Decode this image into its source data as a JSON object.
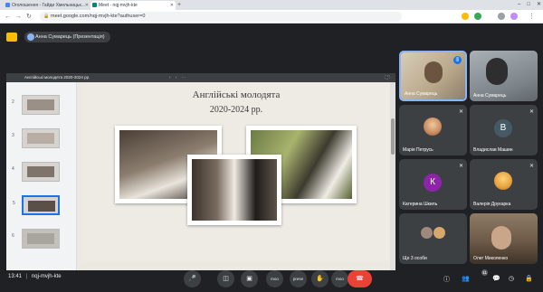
{
  "browser": {
    "tabs": [
      {
        "label": "Оголошення - Гайди Хмельницьк...",
        "fav_color": "#4285f4",
        "active": false
      },
      {
        "label": "Meet - nqj-mvjh-kte",
        "fav_color": "#00897b",
        "active": true
      }
    ],
    "url": "meet.google.com/nqj-mvjh-kte?authuser=0",
    "new_tab": "+",
    "window_controls": [
      "–",
      "□",
      "✕"
    ]
  },
  "meet": {
    "header_chip": "Анна Сумарець (Презентація)",
    "bottom": {
      "time": "13:41",
      "separator": "|",
      "meeting_code": "nqj-mvjh-kte"
    },
    "controls": [
      {
        "name": "mic-button",
        "glyph": "🎤"
      },
      {
        "name": "camera-button",
        "glyph": "◫"
      },
      {
        "name": "present-button",
        "glyph": "▣"
      },
      {
        "name": "more-button-1",
        "glyph": "moo",
        "small": true
      },
      {
        "name": "present-label-button",
        "glyph": "prese",
        "small": true
      },
      {
        "name": "raise-hand-button",
        "glyph": "✋"
      },
      {
        "name": "more-button-2",
        "glyph": "moo",
        "small": true
      }
    ],
    "hangup_glyph": "☎",
    "participant_count": "11",
    "right_icons": [
      "ⓘ",
      "👥",
      "💬",
      "◷",
      "🔒"
    ]
  },
  "slides": {
    "toolbar_title": "Англійські молодята 2020-2024 рр.",
    "toolbar_dots": "‹ › ⋯",
    "toolbar_right": "⛶ ⋮",
    "thumbnail_numbers": [
      "2",
      "3",
      "4",
      "5",
      "6"
    ],
    "selected_thumbnail": 3,
    "slide_title": "Англійські молодята",
    "slide_subtitle": "2020-2024 рр."
  },
  "participants": [
    {
      "name": "Анна Сумарець",
      "type": "video",
      "speaking": true,
      "color": "#c9b79a"
    },
    {
      "name": "Анна Сумарець",
      "type": "video",
      "speaking": false,
      "color": "#8a8f94"
    },
    {
      "name": "Марія Петрусь",
      "type": "photo",
      "color": "#c98a5e"
    },
    {
      "name": "Владислав Машин",
      "type": "letter",
      "letter": "В",
      "color": "#455a64"
    },
    {
      "name": "Катерина Шкиль",
      "type": "letter",
      "letter": "К",
      "color": "#8e24aa"
    },
    {
      "name": "Валерія Друкарка",
      "type": "photo",
      "color": "#e6a23c"
    },
    {
      "name": "Ще 3 особи",
      "type": "photo",
      "color": "#a1887f"
    },
    {
      "name": "Олег Миколенко",
      "type": "video",
      "color": "#6d5a48"
    }
  ],
  "colors": {
    "meet_bg": "#202124",
    "tile_bg": "#3c4043",
    "hangup": "#ea4335",
    "accent": "#8ab4f8",
    "slide_bg": "#eeebe5"
  }
}
